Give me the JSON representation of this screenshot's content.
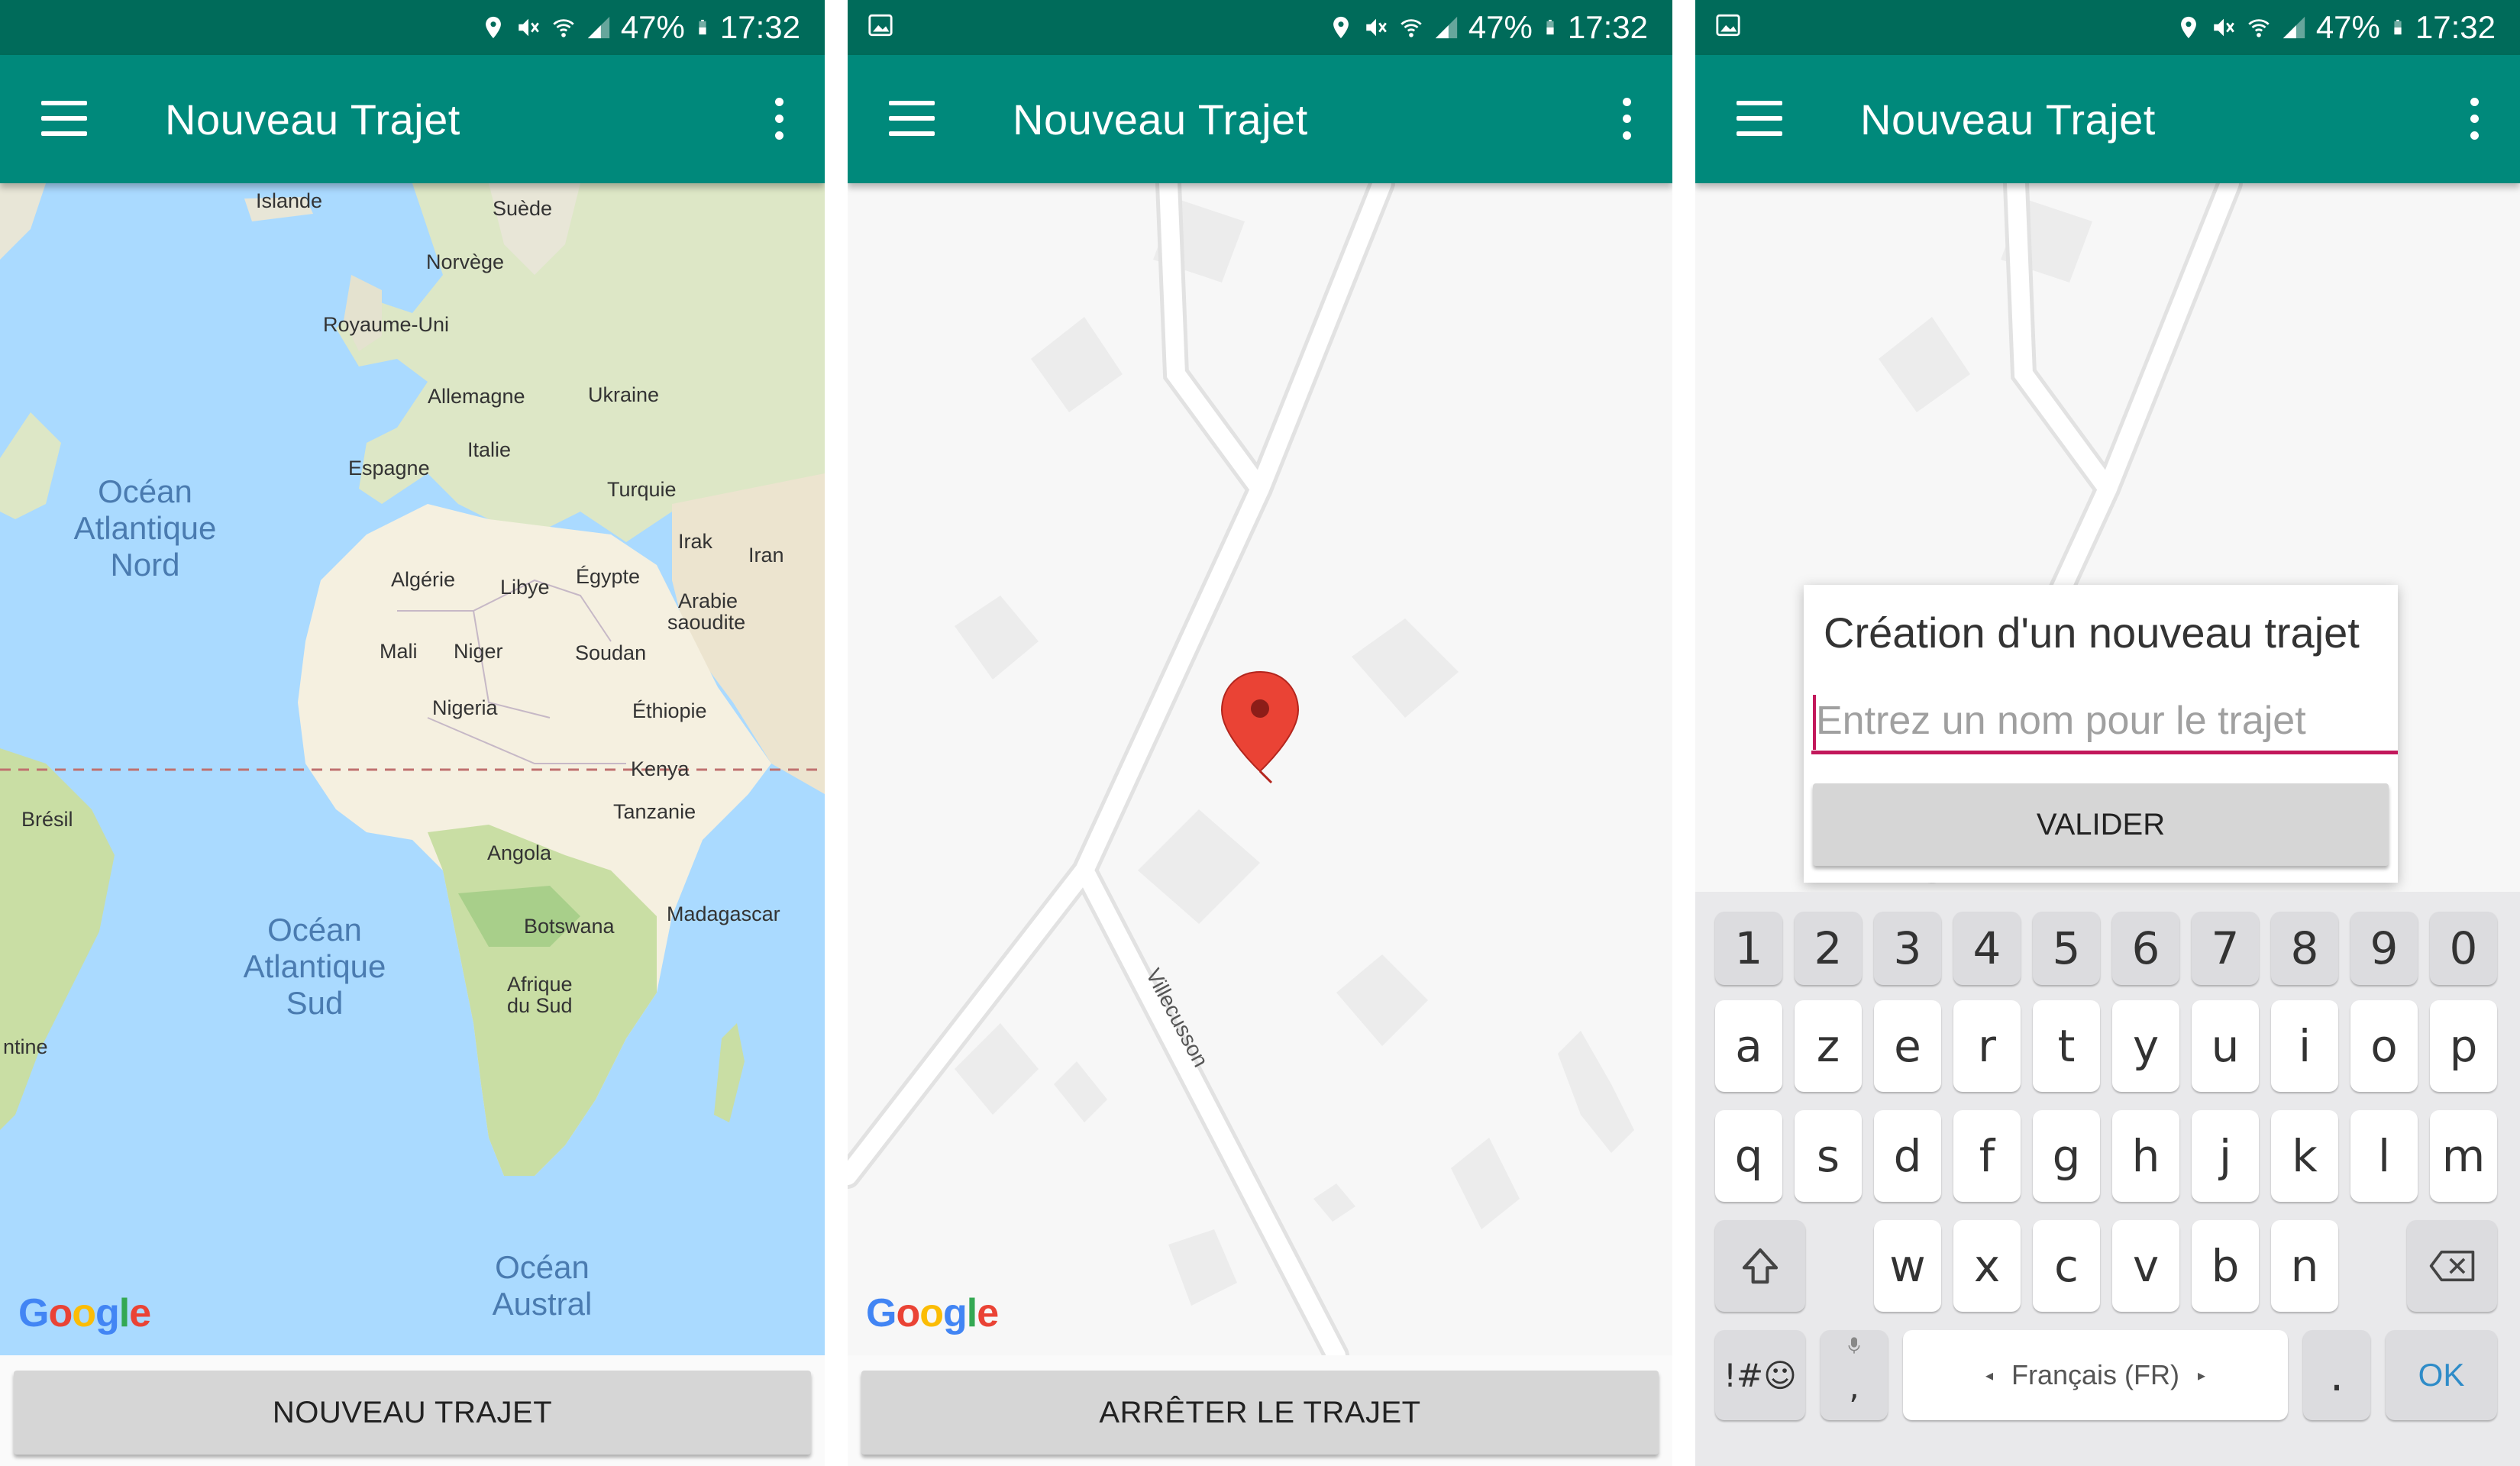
{
  "screens": [
    {
      "status": {
        "battery": "47%",
        "time": "17:32"
      },
      "appbar": {
        "title": "Nouveau Trajet"
      },
      "map_labels": [
        "Islande",
        "Suède",
        "Norvège",
        "Royaume-Uni",
        "Allemagne",
        "Ukraine",
        "Espagne",
        "Italie",
        "Turquie",
        "Océan",
        "Atlantique",
        "Nord",
        "Irak",
        "Iran",
        "Algérie",
        "Libye",
        "Égypte",
        "Arabie",
        "saoudite",
        "Mali",
        "Niger",
        "Soudan",
        "Nigeria",
        "Éthiopie",
        "Kenya",
        "Brésil",
        "Tanzanie",
        "Angola",
        "Madagascar",
        "Botswana",
        "Océan",
        "Atlantique",
        "Sud",
        "Afrique",
        "du Sud",
        "ntine",
        "Océan",
        "Austral"
      ],
      "attribution": "Google",
      "button": {
        "label": "NOUVEAU TRAJET"
      }
    },
    {
      "status": {
        "battery": "47%",
        "time": "17:32"
      },
      "appbar": {
        "title": "Nouveau Trajet"
      },
      "street_label": "Villecusson",
      "attribution": "Google",
      "button": {
        "label": "ARRÊTER LE TRAJET"
      }
    },
    {
      "status": {
        "battery": "47%",
        "time": "17:32"
      },
      "appbar": {
        "title": "Nouveau Trajet"
      },
      "dialog": {
        "title": "Création d'un nouveau trajet",
        "input_placeholder": "Entrez un nom pour le trajet",
        "button": "VALIDER"
      },
      "keyboard": {
        "row_numbers": [
          "1",
          "2",
          "3",
          "4",
          "5",
          "6",
          "7",
          "8",
          "9",
          "0"
        ],
        "row1": [
          "a",
          "z",
          "e",
          "r",
          "t",
          "y",
          "u",
          "i",
          "o",
          "p"
        ],
        "row2": [
          "q",
          "s",
          "d",
          "f",
          "g",
          "h",
          "j",
          "k",
          "l",
          "m"
        ],
        "row3": [
          "w",
          "x",
          "c",
          "v",
          "b",
          "n"
        ],
        "symbols_key": "!#☺",
        "comma_key": ",",
        "space_label": "Français (FR)",
        "period_key": ".",
        "ok_key": "OK"
      }
    }
  ],
  "colors": {
    "statusbar": "#006b5a",
    "appbar": "#00897b",
    "accent_pink": "#c2185b",
    "map_ocean": "#aadaff",
    "map_land": "#e8e6d7",
    "pin_red": "#ea4335"
  },
  "icons": [
    "location-icon",
    "mute-icon",
    "wifi-icon",
    "signal-icon",
    "battery-icon",
    "image-icon",
    "menu-icon",
    "more-vert-icon",
    "map-pin-icon",
    "shift-icon",
    "backspace-icon",
    "mic-icon"
  ]
}
